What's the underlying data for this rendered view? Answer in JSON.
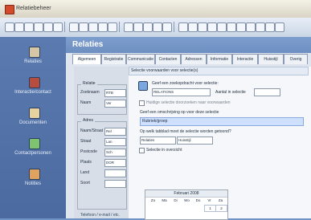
{
  "window": {
    "title": "Relatiebeheer"
  },
  "sidebar": {
    "items": [
      {
        "label": "Relaties",
        "color": "#d7c6a6"
      },
      {
        "label": "Interactie/contact",
        "color": "#b64d3e"
      },
      {
        "label": "Documenten",
        "color": "#e8d1a0"
      },
      {
        "label": "Contactpersonen",
        "color": "#7ec36f"
      },
      {
        "label": "Notities",
        "color": "#e0a25f"
      }
    ]
  },
  "header": {
    "title": "Relaties"
  },
  "tabs": [
    "Algemeen",
    "Registratie",
    "Communicatie",
    "Contacten",
    "Adressen",
    "Informatie",
    "Interactie",
    "Huisstijl",
    "Overig"
  ],
  "left": {
    "relatie": {
      "title": "Relatie",
      "fields": [
        {
          "label": "Zoeknaam",
          "value": "RTB"
        },
        {
          "label": "Naam",
          "value": "Ver"
        }
      ]
    },
    "adres": {
      "title": "Adres",
      "fields": [
        {
          "label": "Naam/Straat",
          "value": "Rel"
        },
        {
          "label": "Straat",
          "value": "Lan"
        },
        {
          "label": "Postcode",
          "value": "Sch"
        },
        {
          "label": "Plaats",
          "value": "DOR"
        },
        {
          "label": "Land",
          "value": ""
        },
        {
          "label": "Soort",
          "value": ""
        }
      ]
    },
    "bottom_label": "Telefoon / e-mail / etc."
  },
  "right": {
    "section_title": "Selectie voorwaarden voor selectie(s)",
    "search": {
      "hint": "Geef een zoekopdracht voor selectie:",
      "value": "RELATIONS",
      "aux_label": "Aantal in selectie"
    },
    "checkbox1": "Huidige selectie doorzoeken naar voorwaarden",
    "category_hint": "Geef een omschrijving op voor deze selectie",
    "category_value": "Rubriek/groep",
    "result_hint": "Op welk tabblad moet de selectie worden getoond?",
    "result_value": "Relaties",
    "result_value_2": "Huisstijl",
    "checkbox2": "Selectie in overzicht",
    "calendar": {
      "month": "Februari 2008",
      "weekdays": [
        "Zo",
        "Ma",
        "Di",
        "Wo",
        "Do",
        "Vr",
        "Za"
      ],
      "days": [
        "",
        "",
        "",
        "",
        "",
        "1",
        "2"
      ]
    }
  }
}
